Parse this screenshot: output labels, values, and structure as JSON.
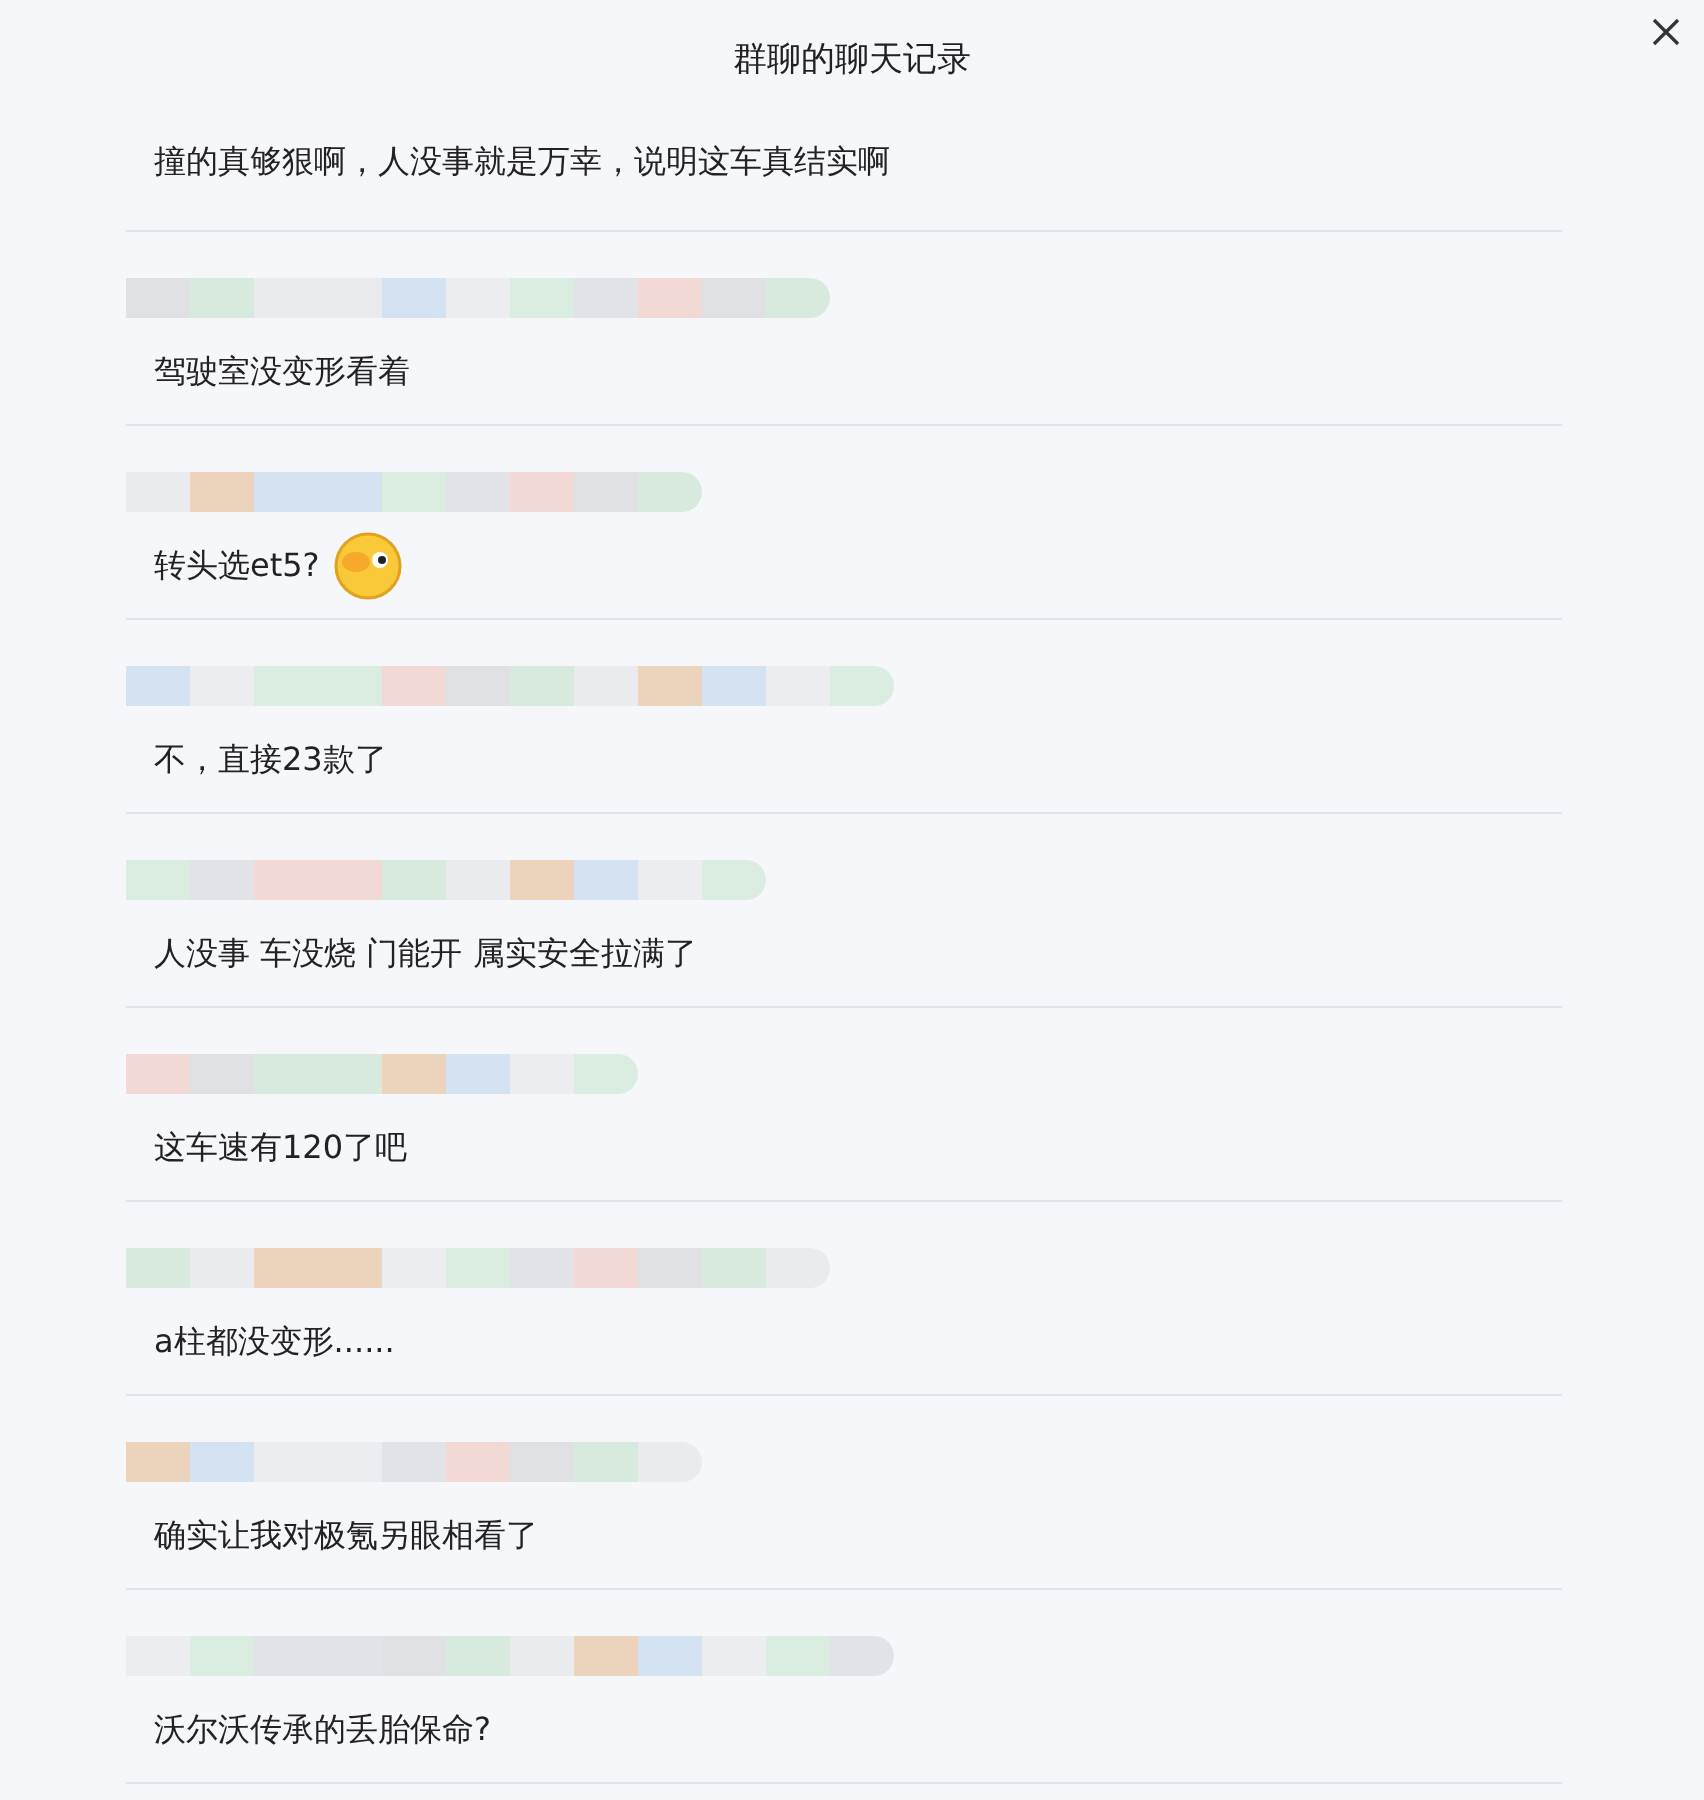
{
  "window": {
    "title": "群聊的聊天记录"
  },
  "messages": [
    {
      "kind": "text",
      "text": "撞的真够狠啊，人没事就是万幸，说明这车真结实啊",
      "sender_hidden": false
    },
    {
      "kind": "text",
      "text": "驾驶室没变形看着",
      "sender_hidden": true
    },
    {
      "kind": "emoji",
      "text": "转头选et5?",
      "sender_hidden": true
    },
    {
      "kind": "text",
      "text": "不，直接23款了",
      "sender_hidden": true
    },
    {
      "kind": "text",
      "text": "人没事 车没烧 门能开 属实安全拉满了",
      "sender_hidden": true
    },
    {
      "kind": "text",
      "text": "这车速有120了吧",
      "sender_hidden": true
    },
    {
      "kind": "text",
      "text": "a柱都没变形......",
      "sender_hidden": true
    },
    {
      "kind": "text",
      "text": "确实让我对极氪另眼相看了",
      "sender_hidden": true
    },
    {
      "kind": "text",
      "text": "沃尔沃传承的丢胎保命?",
      "sender_hidden": true
    }
  ]
}
